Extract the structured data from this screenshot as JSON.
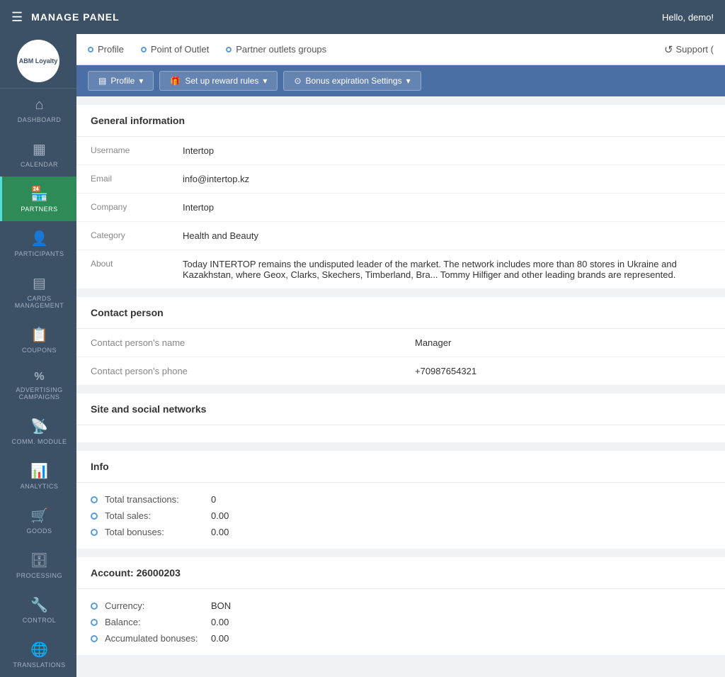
{
  "topbar": {
    "title": "MANAGE PANEL",
    "greeting": "Hello, demo!"
  },
  "logo": {
    "text": "ABM Loyalty"
  },
  "sidebar": {
    "items": [
      {
        "id": "dashboard",
        "label": "DASHBOARD",
        "icon": "⌂",
        "active": false
      },
      {
        "id": "calendar",
        "label": "CALENDAR",
        "icon": "📅",
        "active": false
      },
      {
        "id": "partners",
        "label": "PARTNERS",
        "icon": "🏪",
        "active": true
      },
      {
        "id": "participants",
        "label": "PARTICIPANTS",
        "icon": "👤",
        "active": false
      },
      {
        "id": "cards",
        "label": "CARDS MANAGEMENT",
        "icon": "🃏",
        "active": false
      },
      {
        "id": "coupons",
        "label": "COUPONS",
        "icon": "🗒",
        "active": false
      },
      {
        "id": "advertising",
        "label": "ADVERTISING CAMPAIGNS",
        "icon": "%",
        "active": false
      },
      {
        "id": "comm",
        "label": "COMM. MODULE",
        "icon": "📡",
        "active": false
      },
      {
        "id": "analytics",
        "label": "ANALYTICS",
        "icon": "📈",
        "active": false
      },
      {
        "id": "goods",
        "label": "GOODS",
        "icon": "🛒",
        "active": false
      },
      {
        "id": "processing",
        "label": "PROCESSING",
        "icon": "🗄",
        "active": false
      },
      {
        "id": "control",
        "label": "CONTROL",
        "icon": "🔧",
        "active": false
      },
      {
        "id": "translations",
        "label": "TRANSLATIONS",
        "icon": "🌐",
        "active": false
      }
    ]
  },
  "secondary_nav": {
    "items": [
      {
        "id": "profile",
        "label": "Profile"
      },
      {
        "id": "point-of-outlet",
        "label": "Point of Outlet"
      },
      {
        "id": "partner-outlets",
        "label": "Partner outlets groups"
      }
    ],
    "support": "Support ("
  },
  "action_bar": {
    "profile_btn": "Profile",
    "setup_btn": "Set up reward rules",
    "bonus_btn": "Bonus expiration Settings"
  },
  "general_info": {
    "section_title": "General information",
    "fields": [
      {
        "label": "Username",
        "value": "Intertop"
      },
      {
        "label": "Email",
        "value": "info@intertop.kz"
      },
      {
        "label": "Company",
        "value": "Intertop"
      },
      {
        "label": "Category",
        "value": "Health and Beauty"
      },
      {
        "label": "About",
        "value": "Today INTERTOP remains the undisputed leader of the market. The network includes more than 80 stores in Ukraine and Kazakhstan, where Geox, Clarks, Skechers, Timberland, Bra... Tommy Hilfiger and other leading brands are represented."
      }
    ]
  },
  "contact_person": {
    "section_title": "Contact person",
    "fields": [
      {
        "label": "Contact person's name",
        "value": "Manager"
      },
      {
        "label": "Contact person's phone",
        "value": "+70987654321"
      }
    ]
  },
  "site_social": {
    "section_title": "Site and social networks"
  },
  "info": {
    "section_title": "Info",
    "items": [
      {
        "label": "Total transactions:",
        "value": "0"
      },
      {
        "label": "Total sales:",
        "value": "0.00"
      },
      {
        "label": "Total bonuses:",
        "value": "0.00"
      }
    ]
  },
  "account": {
    "title": "Account:",
    "number": "26000203",
    "items": [
      {
        "label": "Currency:",
        "value": "BON"
      },
      {
        "label": "Balance:",
        "value": "0.00"
      },
      {
        "label": "Accumulated bonuses:",
        "value": "0.00"
      }
    ]
  }
}
